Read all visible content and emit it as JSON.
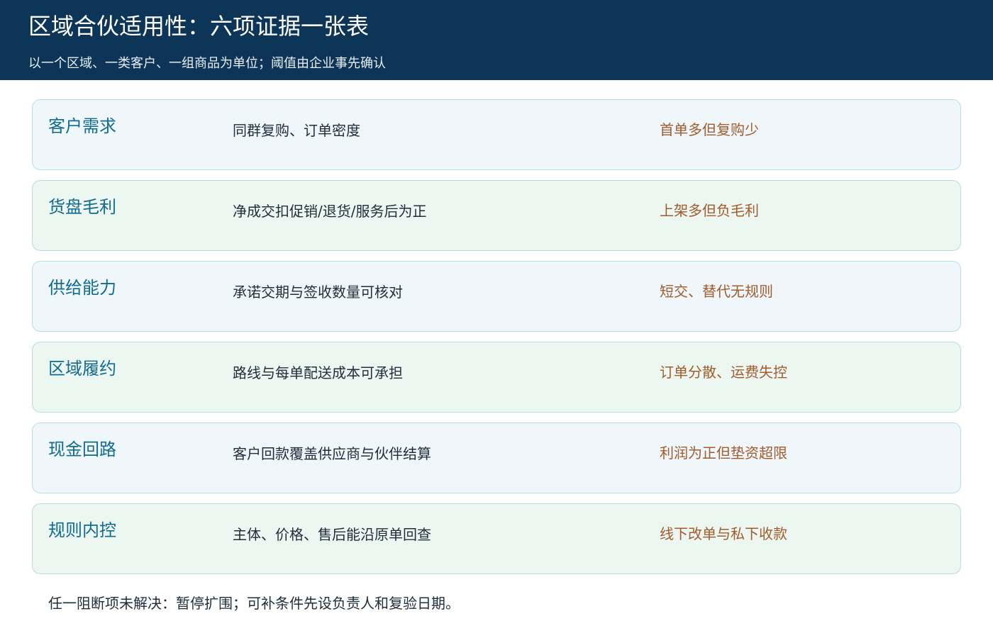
{
  "header": {
    "title": "区域合伙适用性：六项证据一张表",
    "subtitle": "以一个区域、一类客户、一组商品为单位；阈值由企业事先确认"
  },
  "rows": [
    {
      "title": "客户需求",
      "evidence": "同群复购、订单密度",
      "risk": "首单多但复购少"
    },
    {
      "title": "货盘毛利",
      "evidence": "净成交扣促销/退货/服务后为正",
      "risk": "上架多但负毛利"
    },
    {
      "title": "供给能力",
      "evidence": "承诺交期与签收数量可核对",
      "risk": "短交、替代无规则"
    },
    {
      "title": "区域履约",
      "evidence": "路线与每单配送成本可承担",
      "risk": "订单分散、运费失控"
    },
    {
      "title": "现金回路",
      "evidence": "客户回款覆盖供应商与伙伴结算",
      "risk": "利润为正但垫资超限"
    },
    {
      "title": "规则内控",
      "evidence": "主体、价格、售后能沿原单回查",
      "risk": "线下改单与私下收款"
    }
  ],
  "footer": {
    "note": "任一阻断项未解决：暂停扩围；可补条件先设负责人和复验日期。"
  },
  "colors": {
    "header_bg": "#0d3557",
    "row_blue_bg": "#eff7fb",
    "row_green_bg": "#edf7f1",
    "row_border": "#b8dbe8",
    "title_color": "#116b91",
    "risk_color": "#a35b2c",
    "text_color": "#1f2d3a"
  }
}
